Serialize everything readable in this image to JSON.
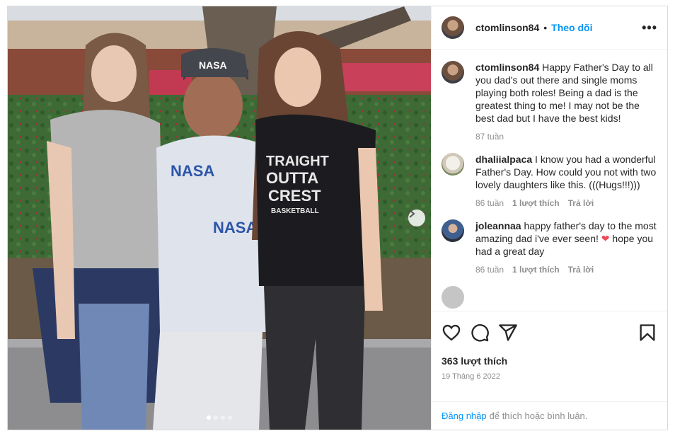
{
  "post": {
    "username": "ctomlinson84",
    "follow_label": "Theo dõi",
    "more_label": "•••",
    "carousel": {
      "slide_count": 4,
      "active_index": 0
    },
    "photo": {
      "cap_text": "NASA",
      "shirt_text": "NASA",
      "tee_lines": [
        "TRAIGHT",
        "OUTTA",
        "CREST",
        "BASKETBALL"
      ]
    }
  },
  "comments": [
    {
      "user": "ctomlinson84",
      "text": "Happy Father's Day to all you dad's out there and single moms playing both roles! Being a dad is the greatest thing to me! I may not be the best dad but I have the best kids!",
      "time": "87 tuần",
      "avatar": "main"
    },
    {
      "user": "dhaliialpaca",
      "text": "I know you had a wonderful Father's Day. How could you not with two lovely daughters like this. (((Hugs!!!)))",
      "time": "86 tuần",
      "likes": "1 lượt thích",
      "reply": "Trả lời",
      "avatar": "dhal"
    },
    {
      "user": "joleannaa",
      "text": "happy father's day to the most amazing dad i've ever seen!",
      "emoji": "❤",
      "text_after": "hope you had a great day",
      "time": "86 tuần",
      "likes": "1 lượt thích",
      "reply": "Trả lời",
      "avatar": "jole"
    }
  ],
  "actions": {
    "icons": [
      "heart-icon",
      "comment-icon",
      "share-icon",
      "bookmark-icon"
    ],
    "likes": "363 lượt thích",
    "date": "19 Tháng 6 2022"
  },
  "footer": {
    "login_link": "Đăng nhập",
    "login_rest": "để thích hoặc bình luận."
  },
  "colors": {
    "accent": "#0095f6",
    "muted": "#8e8e8e",
    "text": "#262626",
    "heart": "#ed4956"
  }
}
